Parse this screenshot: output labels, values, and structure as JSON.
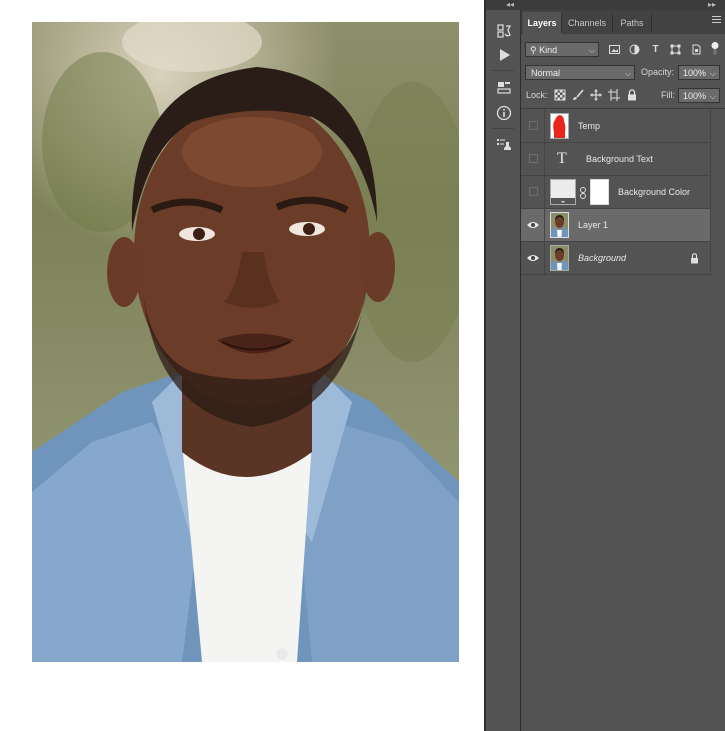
{
  "panel": {
    "tabs": [
      {
        "label": "Layers",
        "active": true
      },
      {
        "label": "Channels",
        "active": false
      },
      {
        "label": "Paths",
        "active": false
      }
    ],
    "filter": {
      "kind_label": "Kind",
      "filter_icons": [
        "image-filter-icon",
        "adjustment-filter-icon",
        "type-filter-icon",
        "shape-filter-icon",
        "smart-object-filter-icon"
      ]
    },
    "blend": {
      "mode": "Normal",
      "opacity_label": "Opacity:",
      "opacity_value": "100%"
    },
    "lock": {
      "lock_label": "Lock:",
      "lock_icons": [
        "lock-transparent-icon",
        "lock-image-icon",
        "lock-position-icon",
        "lock-artboard-icon",
        "lock-all-icon"
      ],
      "fill_label": "Fill:",
      "fill_value": "100%"
    },
    "layers": [
      {
        "name": "Temp",
        "visible": false,
        "selected": false,
        "thumb": "red-silhouette",
        "locked": false,
        "italic": false
      },
      {
        "name": "Background Text",
        "visible": false,
        "selected": false,
        "thumb": "type",
        "locked": false,
        "italic": false
      },
      {
        "name": "Background Color",
        "visible": false,
        "selected": false,
        "thumb": "fill-with-mask",
        "locked": false,
        "italic": false
      },
      {
        "name": "Layer 1",
        "visible": true,
        "selected": true,
        "thumb": "portrait",
        "locked": false,
        "italic": false
      },
      {
        "name": "Background",
        "visible": true,
        "selected": false,
        "thumb": "portrait",
        "locked": true,
        "italic": true
      }
    ]
  },
  "colors": {
    "panel_bg": "#535353",
    "selected_row": "#6a6a6a",
    "temp_thumb_red": "#e8261c"
  }
}
